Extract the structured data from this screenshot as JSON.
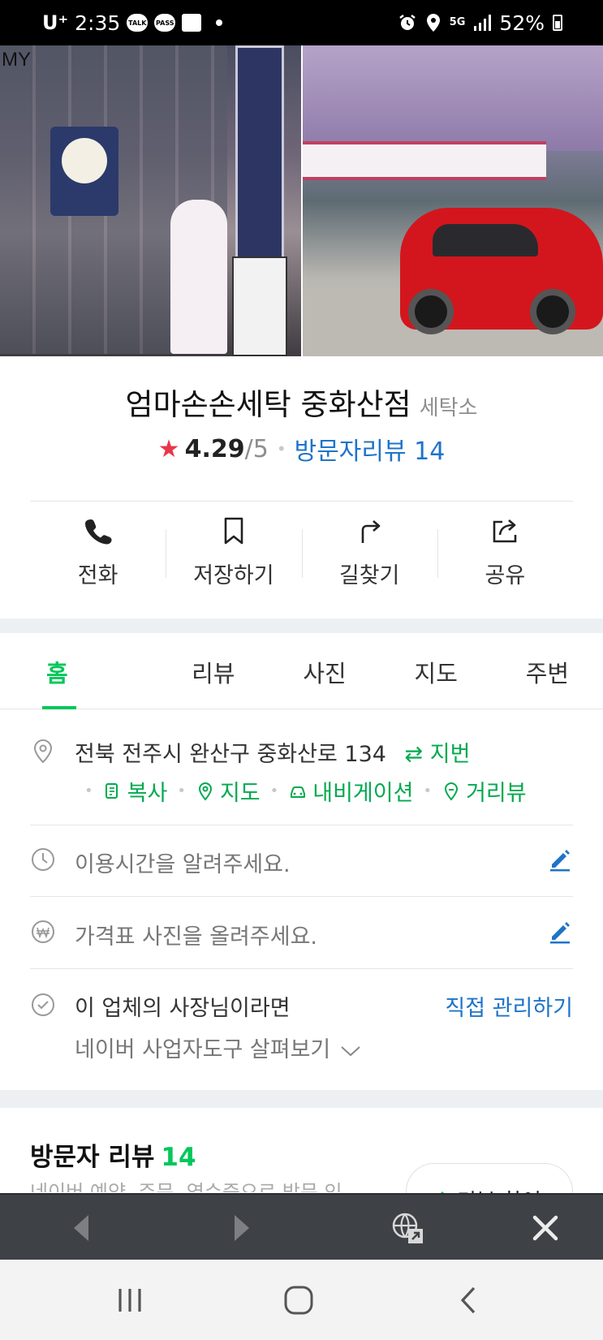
{
  "status_bar": {
    "carrier": "U⁺",
    "time": "2:35",
    "notif_icons": [
      "talk-icon",
      "pass-icon",
      "gallery-icon"
    ],
    "talk_label": "TALK",
    "pass_label": "PASS",
    "right_icons": [
      "alarm-icon",
      "location-icon",
      "5g-icon",
      "signal-icon"
    ],
    "net": "5G",
    "battery": "52%"
  },
  "photos": {
    "corner_label": "MY"
  },
  "place": {
    "name": "엄마손손세탁 중화산점",
    "category": "세탁소",
    "rating": "4.29",
    "rating_max": "/5",
    "review_link": "방문자리뷰 14"
  },
  "actions": [
    {
      "label": "전화",
      "icon": "phone-icon"
    },
    {
      "label": "저장하기",
      "icon": "bookmark-icon"
    },
    {
      "label": "길찾기",
      "icon": "directions-icon"
    },
    {
      "label": "공유",
      "icon": "share-icon"
    }
  ],
  "tabs": [
    "홈",
    "리뷰",
    "사진",
    "지도",
    "주변"
  ],
  "active_tab": "홈",
  "info": {
    "address": "전북 전주시 완산구 중화산로 134",
    "address_toggle": "지번",
    "address_links": [
      "복사",
      "지도",
      "내비게이션",
      "거리뷰"
    ],
    "hours_prompt": "이용시간을 알려주세요.",
    "price_prompt": "가격표 사진을 올려주세요.",
    "owner_prompt": "이 업체의 사장님이라면",
    "owner_link": "직접 관리하기",
    "owner_tools": "네이버 사업자도구 살펴보기"
  },
  "reviews": {
    "title": "방문자 리뷰",
    "count": "14",
    "subtitle": "네이버 예약, 주문, 영수증으로 방문 인",
    "write_button": "리뷰 참여"
  },
  "colors": {
    "accent_green": "#03c75a",
    "link_blue": "#1e74c8",
    "star_red": "#e8364a"
  }
}
